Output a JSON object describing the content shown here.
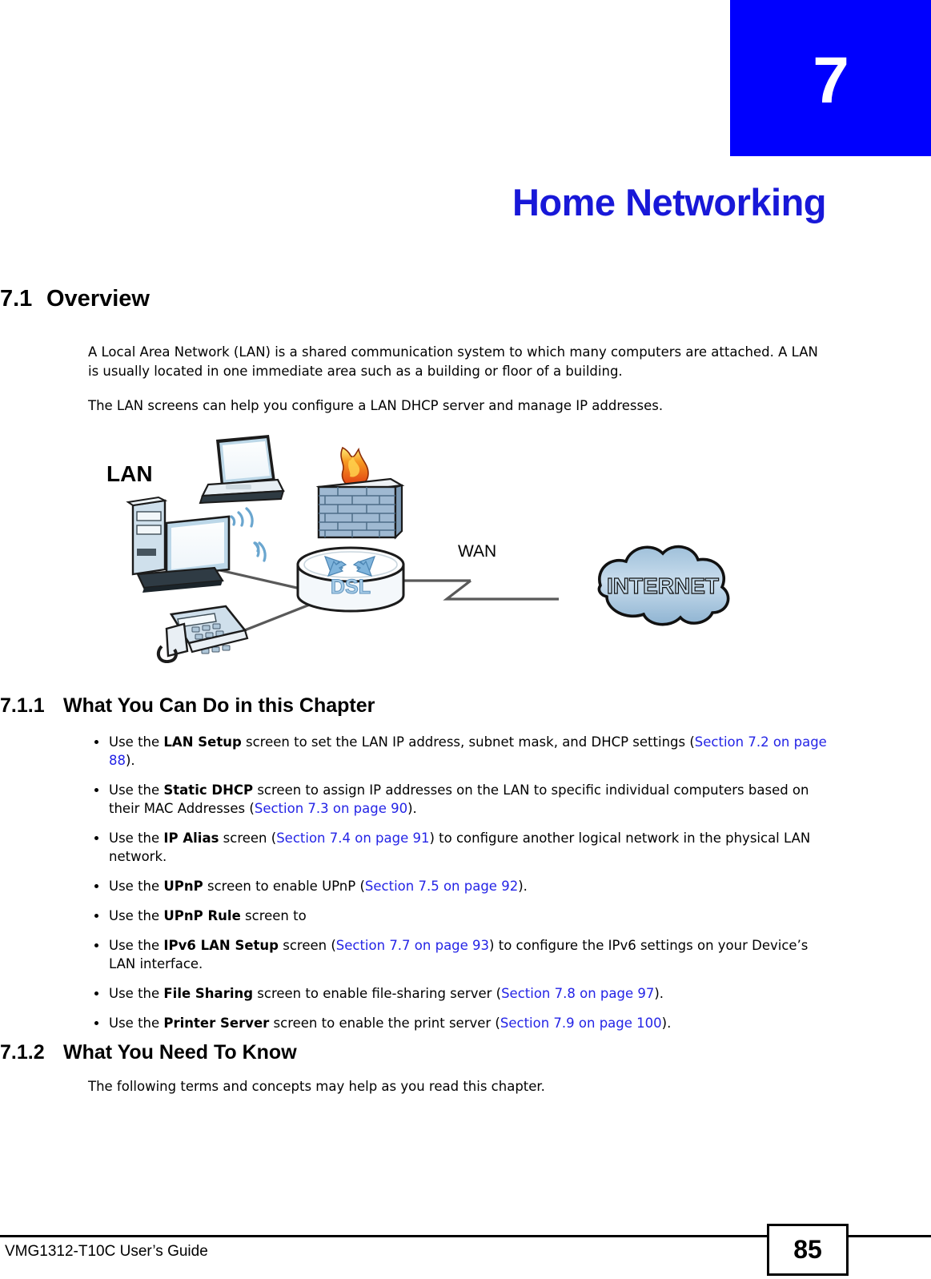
{
  "chapter": {
    "number": "7",
    "title": "Home Networking",
    "banner_color": "#0000fe",
    "title_color": "#1818d8"
  },
  "sections": {
    "overview": {
      "number": "7.1",
      "title": "Overview",
      "paragraph1": "A Local Area Network (LAN) is a shared communication system to which many computers are attached. A LAN is usually located in one immediate area such as a building or floor of a building.",
      "paragraph2": "The LAN screens can help you configure a LAN DHCP server and manage IP addresses."
    },
    "what_you_can_do": {
      "number": "7.1.1",
      "title": "What You Can Do in this Chapter"
    },
    "what_you_need_to_know": {
      "number": "7.1.2",
      "title": "What You Need To Know",
      "paragraph1": "The following terms and concepts may help as you read this chapter."
    }
  },
  "bullets": [
    {
      "parts": [
        {
          "t": "Use the ",
          "s": "plain"
        },
        {
          "t": "LAN Setup",
          "s": "bold"
        },
        {
          "t": " screen to set the LAN IP address, subnet mask, and DHCP settings (",
          "s": "plain"
        },
        {
          "t": "Section 7.2 on page 88",
          "s": "link"
        },
        {
          "t": ").",
          "s": "plain"
        }
      ]
    },
    {
      "parts": [
        {
          "t": "Use the ",
          "s": "plain"
        },
        {
          "t": "Static DHCP",
          "s": "bold"
        },
        {
          "t": " screen to assign IP addresses on the LAN to specific individual computers based on their MAC Addresses (",
          "s": "plain"
        },
        {
          "t": "Section 7.3 on page 90",
          "s": "link"
        },
        {
          "t": ").",
          "s": "plain"
        }
      ]
    },
    {
      "parts": [
        {
          "t": "Use the ",
          "s": "plain"
        },
        {
          "t": "IP Alias",
          "s": "bold"
        },
        {
          "t": " screen (",
          "s": "plain"
        },
        {
          "t": "Section 7.4 on page 91",
          "s": "link"
        },
        {
          "t": ") to configure another logical network in the physical LAN network.",
          "s": "plain"
        }
      ]
    },
    {
      "parts": [
        {
          "t": "Use the ",
          "s": "plain"
        },
        {
          "t": "UPnP",
          "s": "bold"
        },
        {
          "t": " screen to enable UPnP (",
          "s": "plain"
        },
        {
          "t": "Section 7.5 on page 92",
          "s": "link"
        },
        {
          "t": ").",
          "s": "plain"
        }
      ]
    },
    {
      "parts": [
        {
          "t": "Use the ",
          "s": "plain"
        },
        {
          "t": "UPnP Rule",
          "s": "bold"
        },
        {
          "t": " screen to",
          "s": "plain"
        }
      ]
    },
    {
      "parts": [
        {
          "t": "Use the ",
          "s": "plain"
        },
        {
          "t": "IPv6 LAN Setup",
          "s": "bold"
        },
        {
          "t": " screen (",
          "s": "plain"
        },
        {
          "t": "Section 7.7 on page 93",
          "s": "link"
        },
        {
          "t": ") to configure the IPv6 settings on your Device’s LAN interface.",
          "s": "plain"
        }
      ]
    },
    {
      "parts": [
        {
          "t": "Use the ",
          "s": "plain"
        },
        {
          "t": "File Sharing",
          "s": "bold"
        },
        {
          "t": " screen to enable file-sharing server (",
          "s": "plain"
        },
        {
          "t": "Section 7.8 on page 97",
          "s": "link"
        },
        {
          "t": ").",
          "s": "plain"
        }
      ]
    },
    {
      "parts": [
        {
          "t": "Use the ",
          "s": "plain"
        },
        {
          "t": "Printer Server",
          "s": "bold"
        },
        {
          "t": " screen to enable the print server (",
          "s": "plain"
        },
        {
          "t": "Section 7.9 on page 100",
          "s": "link"
        },
        {
          "t": ").",
          "s": "plain"
        }
      ]
    }
  ],
  "diagram": {
    "lan_label": "LAN",
    "wan_label": "WAN",
    "router_label": "DSL",
    "cloud_label": "INTERNET",
    "nodes": [
      "laptop",
      "desktop-computer",
      "ip-phone",
      "wireless-signal",
      "firewall-brick",
      "dsl-router",
      "internet-cloud"
    ]
  },
  "footer": {
    "guide_title": "VMG1312-T10C User’s Guide",
    "page_number": "85"
  }
}
